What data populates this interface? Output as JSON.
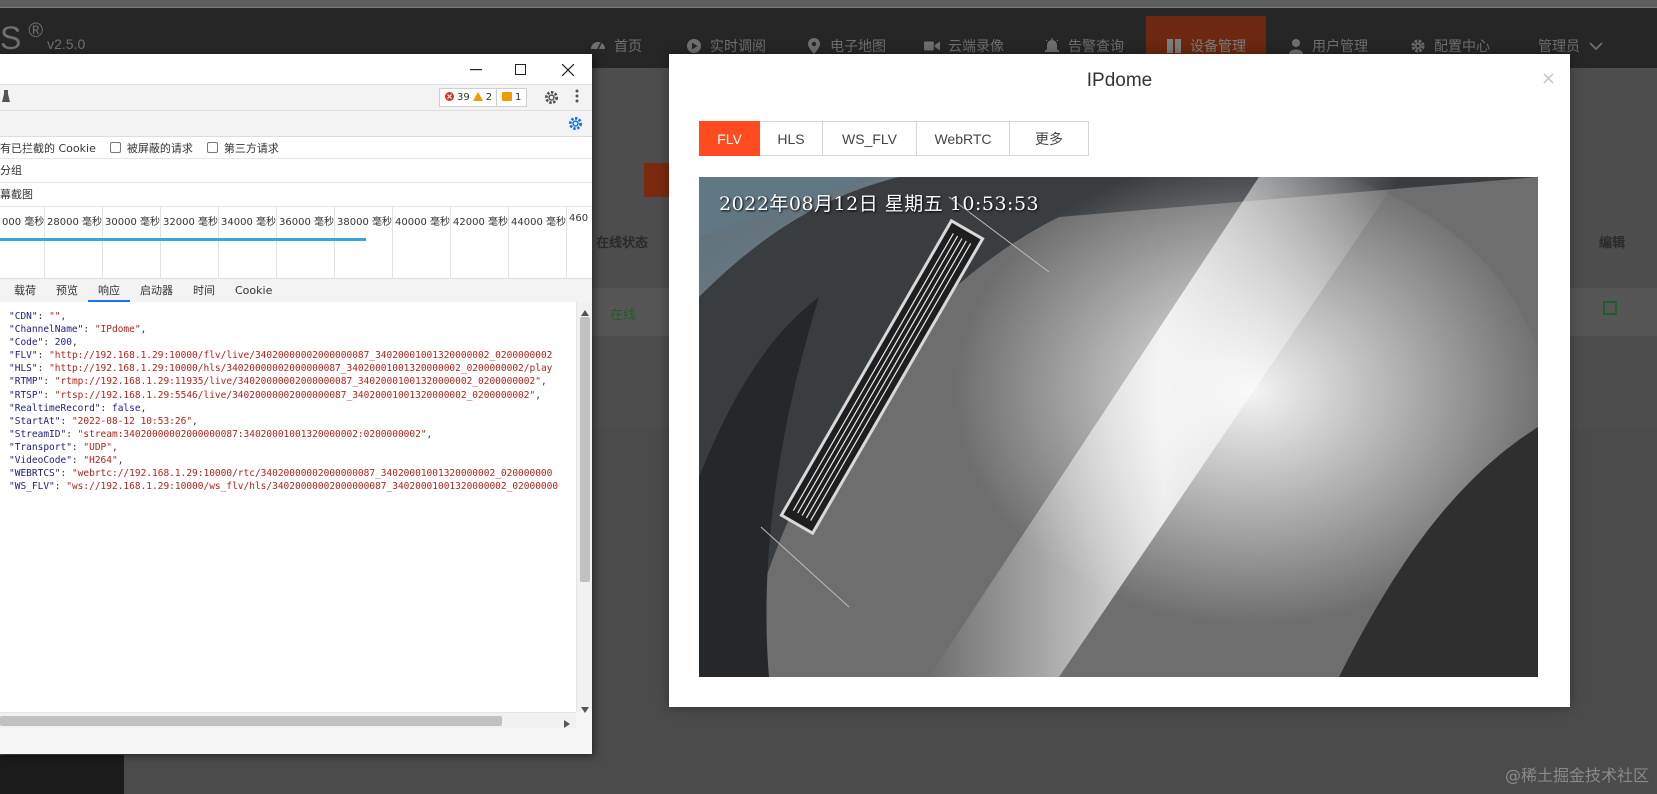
{
  "app": {
    "brand": "S",
    "reg_mark": "®",
    "version": "v2.5.0",
    "nav": [
      {
        "label": "首页",
        "icon": "dashboard-icon"
      },
      {
        "label": "实时调阅",
        "icon": "play-circle-icon"
      },
      {
        "label": "电子地图",
        "icon": "map-marker-icon"
      },
      {
        "label": "云端录像",
        "icon": "video-camera-icon"
      },
      {
        "label": "告警查询",
        "icon": "alarm-bell-icon"
      },
      {
        "label": "设备管理",
        "icon": "book-icon",
        "active": true
      },
      {
        "label": "用户管理",
        "icon": "user-icon"
      },
      {
        "label": "配置中心",
        "icon": "gear-icon"
      }
    ],
    "user_menu": "管理员",
    "table": {
      "headers": {
        "status": "在线状态",
        "edit": "编辑"
      },
      "row": {
        "status": "在线"
      }
    },
    "watermark": "@稀土掘金技术社区"
  },
  "devtools": {
    "badges": {
      "errors": "39",
      "warnings": "2",
      "issues": "1"
    },
    "filter": {
      "blocked_cookie": "有已拦截的 Cookie",
      "blocked_requests": "被屏蔽的请求",
      "third_party": "第三方请求"
    },
    "group_label": "分组",
    "screenshot_label": "幕截图",
    "timeline_ticks": [
      "000 毫秒",
      "28000 毫秒",
      "30000 毫秒",
      "32000 毫秒",
      "34000 毫秒",
      "36000 毫秒",
      "38000 毫秒",
      "40000 毫秒",
      "42000 毫秒",
      "44000 毫秒",
      "460"
    ],
    "tabs": [
      "载荷",
      "预览",
      "响应",
      "启动器",
      "时间",
      "Cookie"
    ],
    "selected_tab": "响应",
    "response": [
      {
        "key": "\"CDN\"",
        "value": "\"\"",
        "kind": "s"
      },
      {
        "key": "\"ChannelName\"",
        "value": "\"IPdome\"",
        "kind": "s"
      },
      {
        "key": "\"Code\"",
        "value": "200",
        "kind": "n"
      },
      {
        "key": "\"FLV\"",
        "value": "\"http://192.168.1.29:10000/flv/live/34020000002000000087_34020001001320000002_0200000002",
        "kind": "s"
      },
      {
        "key": "\"HLS\"",
        "value": "\"http://192.168.1.29:10000/hls/34020000002000000087_34020001001320000002_0200000002/play",
        "kind": "s"
      },
      {
        "key": "\"RTMP\"",
        "value": "\"rtmp://192.168.1.29:11935/live/34020000002000000087_34020001001320000002_0200000002\"",
        "kind": "s"
      },
      {
        "key": "\"RTSP\"",
        "value": "\"rtsp://192.168.1.29:5546/live/34020000002000000087_34020001001320000002_0200000002\"",
        "kind": "s"
      },
      {
        "key": "\"RealtimeRecord\"",
        "value": "false",
        "kind": "n"
      },
      {
        "key": "\"StartAt\"",
        "value": "\"2022-08-12 10:53:26\"",
        "kind": "s"
      },
      {
        "key": "\"StreamID\"",
        "value": "\"stream:34020000002000000087:34020001001320000002:0200000002\"",
        "kind": "s"
      },
      {
        "key": "\"Transport\"",
        "value": "\"UDP\"",
        "kind": "s"
      },
      {
        "key": "\"VideoCode\"",
        "value": "\"H264\"",
        "kind": "s"
      },
      {
        "key": "\"WEBRTCS\"",
        "value": "\"webrtc://192.168.1.29:10000/rtc/34020000002000000087_34020001001320000002_020000000",
        "kind": "s"
      },
      {
        "key": "\"WS_FLV\"",
        "value": "\"ws://192.168.1.29:10000/ws_flv/hls/34020000002000000087_34020001001320000002_02000000",
        "kind": "s"
      }
    ]
  },
  "modal": {
    "title": "IPdome",
    "close": "×",
    "buttons": [
      "FLV",
      "HLS",
      "WS_FLV",
      "WebRTC",
      "更多"
    ],
    "active_button": "FLV",
    "accent": "#ff4b1f",
    "osd": "2022年08月12日  星期五  10:53:53"
  }
}
